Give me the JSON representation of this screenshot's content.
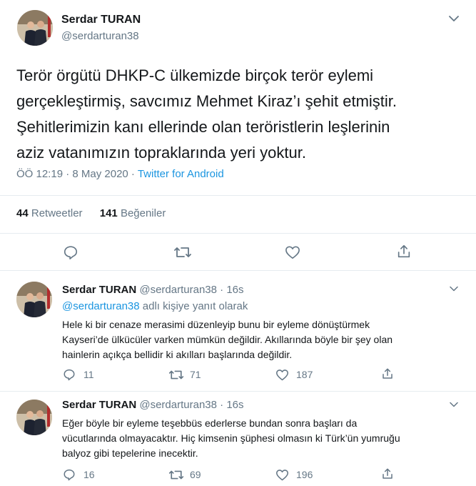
{
  "main_tweet": {
    "author_name": "Serdar TURAN",
    "author_handle": "@serdarturan38",
    "text_lines": [
      "Terör örgütü DHKP-C ülkemizde birçok terör eylemi",
      "gerçekleştirmiş, savcımız Mehmet Kiraz’ı şehit etmiştir.",
      "Şehitlerimizin kanı ellerinde olan teröristlerin leşlerinin",
      "aziz vatanımızın topraklarında yeri yoktur."
    ],
    "timestamp": "ÖÖ 12:19 · 8 May 2020 · ",
    "source": "Twitter for Android",
    "retweets_count": "44",
    "retweets_label": "Retweetler",
    "likes_count": "141",
    "likes_label": "Beğeniler"
  },
  "replies": [
    {
      "author_name": "Serdar TURAN",
      "author_handle": "@serdarturan38",
      "time": "· 16s",
      "replying_handle": "@serdarturan38",
      "replying_suffix": " adlı kişiye yanıt olarak",
      "text_lines": [
        "Hele ki bir cenaze merasimi düzenleyip bunu bir eyleme dönüştürmek",
        "Kayseri’de ülkücüler varken mümkün değildir. Akıllarında böyle bir şey olan",
        "hainlerin açıkça bellidir ki akılları başlarında değildir."
      ],
      "reply_count": "11",
      "retweet_count": "71",
      "like_count": "187"
    },
    {
      "author_name": "Serdar TURAN",
      "author_handle": "@serdarturan38",
      "time": "· 16s",
      "text_lines": [
        "Eğer böyle bir eyleme teşebbüs ederlerse bundan sonra başları da",
        "vücutlarında olmayacaktır. Hiç kimsenin şüphesi olmasın ki Türk’ün yumruğu",
        "balyoz gibi tepelerine inecektir."
      ],
      "reply_count": "16",
      "retweet_count": "69",
      "like_count": "196"
    }
  ],
  "icons": {
    "reply": "reply-icon",
    "retweet": "retweet-icon",
    "like": "heart-icon",
    "share": "share-icon",
    "more": "chevron-down-icon"
  },
  "colors": {
    "link": "#1b95e0",
    "secondary_text": "#657786",
    "border": "#e6ecf0"
  }
}
